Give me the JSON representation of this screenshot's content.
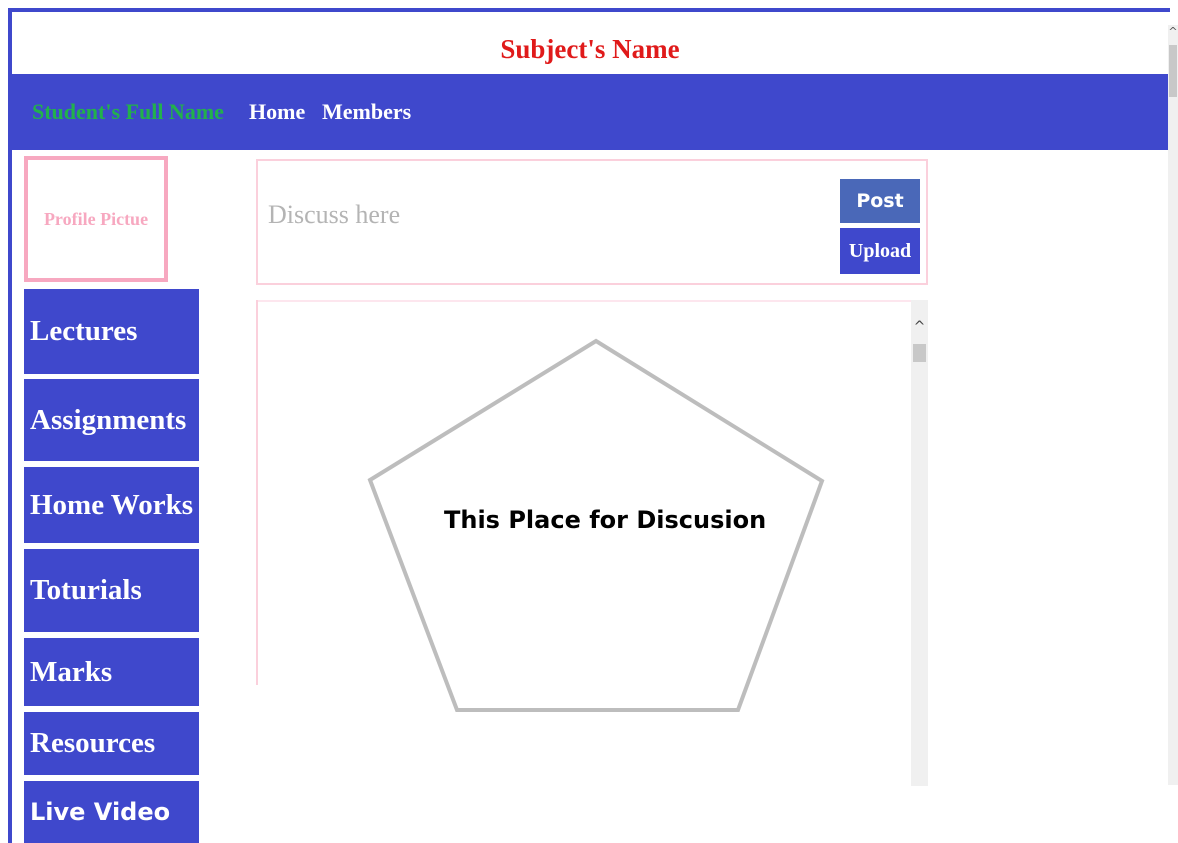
{
  "header": {
    "subject_title": "Subject's Name"
  },
  "navbar": {
    "student_name": "Student's Full Name",
    "links": [
      "Home",
      "Members"
    ]
  },
  "profile": {
    "label": "Profile Pictue"
  },
  "sidebar": {
    "items": [
      {
        "label": "Lectures"
      },
      {
        "label": "Assignments"
      },
      {
        "label": "Home Works"
      },
      {
        "label": "Toturials"
      },
      {
        "label": "Marks"
      },
      {
        "label": "Resources"
      },
      {
        "label": "Live Video"
      }
    ]
  },
  "post_box": {
    "placeholder": "Discuss here",
    "post_label": "Post",
    "upload_label": "Upload"
  },
  "discussion": {
    "label": "This Place for Discusion"
  },
  "icons": {
    "page_scroll_up": "chevron-up-icon",
    "discussion_scroll_up": "chevron-up-icon"
  },
  "colors": {
    "accent": "#3f48cc",
    "title": "#e01a1a",
    "student_name": "#22b14c",
    "profile_border": "#f7a8c0",
    "post_button": "#4a68b8"
  }
}
